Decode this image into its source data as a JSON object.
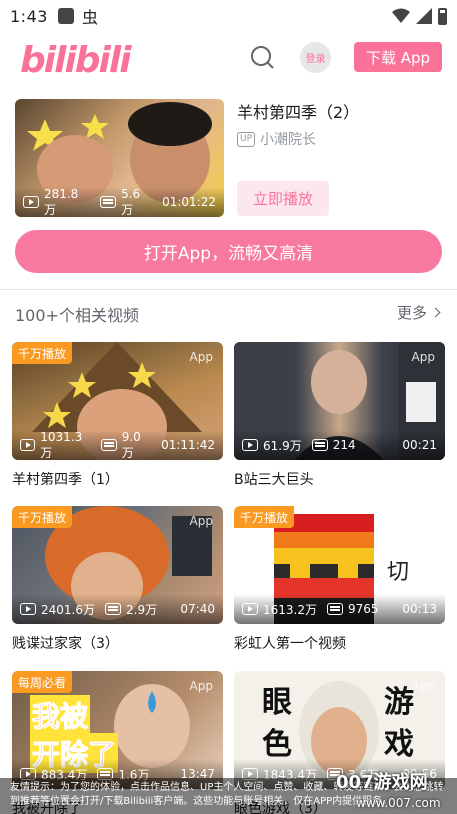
{
  "status_bar": {
    "time": "1:43",
    "bug_glyph": "虫"
  },
  "header": {
    "logo_text": "bilibili",
    "login_label": "登录",
    "download_label": "下载 App"
  },
  "hero": {
    "title": "羊村第四季（2）",
    "uploader": "小潮院长",
    "up_tag": "UP",
    "views": "281.8万",
    "danmaku": "5.6万",
    "duration": "01:01:22",
    "play_now_label": "立即播放"
  },
  "open_app_label": "打开App，流畅又高清",
  "related": {
    "section_title": "100+个相关视频",
    "more_label": "更多",
    "videos": [
      {
        "title": "羊村第四季（1）",
        "badge": "千万播放",
        "views": "1031.3万",
        "danmaku": "9.0万",
        "duration": "01:11:42",
        "app_tag": "App"
      },
      {
        "title": "B站三大巨头",
        "badge": "",
        "views": "61.9万",
        "danmaku": "214",
        "duration": "00:21",
        "app_tag": "App"
      },
      {
        "title": "贱谍过家家（3）",
        "badge": "千万播放",
        "views": "2401.6万",
        "danmaku": "2.9万",
        "duration": "07:40",
        "app_tag": "App"
      },
      {
        "title": "彩虹人第一个视频",
        "badge": "千万播放",
        "views": "1613.2万",
        "danmaku": "9765",
        "duration": "00:13",
        "app_tag": "App",
        "overlay_char": "切"
      },
      {
        "title": "我被开除了",
        "badge": "每周必看",
        "views": "883.4万",
        "danmaku": "1.6万",
        "duration": "13:47",
        "app_tag": "App",
        "thumb_text": [
          "我被",
          "开除了"
        ]
      },
      {
        "title": "眼色游戏（3）",
        "badge": "",
        "views": "1843.4万",
        "danmaku": "3.6万",
        "duration": "09:56",
        "app_tag": "App",
        "thumb_text": [
          "眼",
          "色",
          "游",
          "戏"
        ]
      }
    ]
  },
  "notice": {
    "text": "友情提示：为了您的体验，点击作品信息、UP主个人空间、点赞、收藏、转发等链接，会为您跳转到推荐等位置会打开/下载Bilibili客户端。这些功能与账号相关，仅在APP内提供服务。"
  },
  "watermark": {
    "brand": "007游戏网",
    "url": "www.007.com"
  },
  "colors": {
    "brand_pink": "#fb7299",
    "badge_orange": "#fa9a23"
  }
}
